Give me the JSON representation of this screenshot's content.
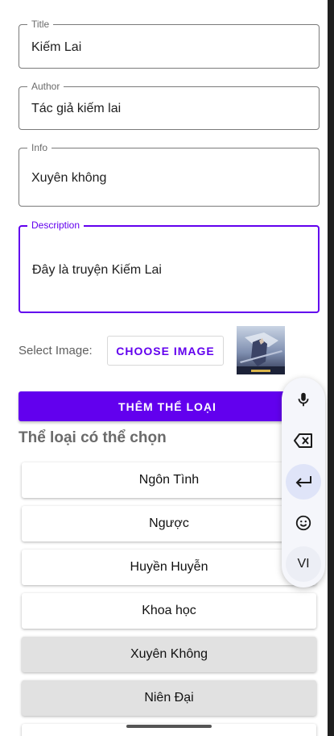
{
  "form": {
    "title": {
      "label": "Title",
      "value": "Kiếm Lai"
    },
    "author": {
      "label": "Author",
      "value": "Tác giả kiếm lai"
    },
    "info": {
      "label": "Info",
      "value": "Xuyên không"
    },
    "description": {
      "label": "Description",
      "value": "Đây là truyện Kiếm Lai"
    }
  },
  "image_picker": {
    "label": "Select Image:",
    "button_label": "CHOOSE IMAGE",
    "thumbnail_icon": "book-cover-thumbnail"
  },
  "add_genre_button": "THÊM THỂ LOẠI",
  "genre_section_title": "Thể loại có thể chọn",
  "genres": [
    {
      "label": "Ngôn Tình",
      "selected": false
    },
    {
      "label": "Ngược",
      "selected": false
    },
    {
      "label": "Huyền Huyễn",
      "selected": false
    },
    {
      "label": "Khoa học",
      "selected": false
    },
    {
      "label": "Xuyên Không",
      "selected": true
    },
    {
      "label": "Niên Đại",
      "selected": true
    }
  ],
  "keyboard_toolbar": {
    "items": [
      "mic-icon",
      "backspace-icon",
      "enter-icon",
      "emoji-icon"
    ],
    "language": "VI"
  },
  "colors": {
    "accent": "#6200ee",
    "selected_genre_bg": "#e1e1e1"
  }
}
